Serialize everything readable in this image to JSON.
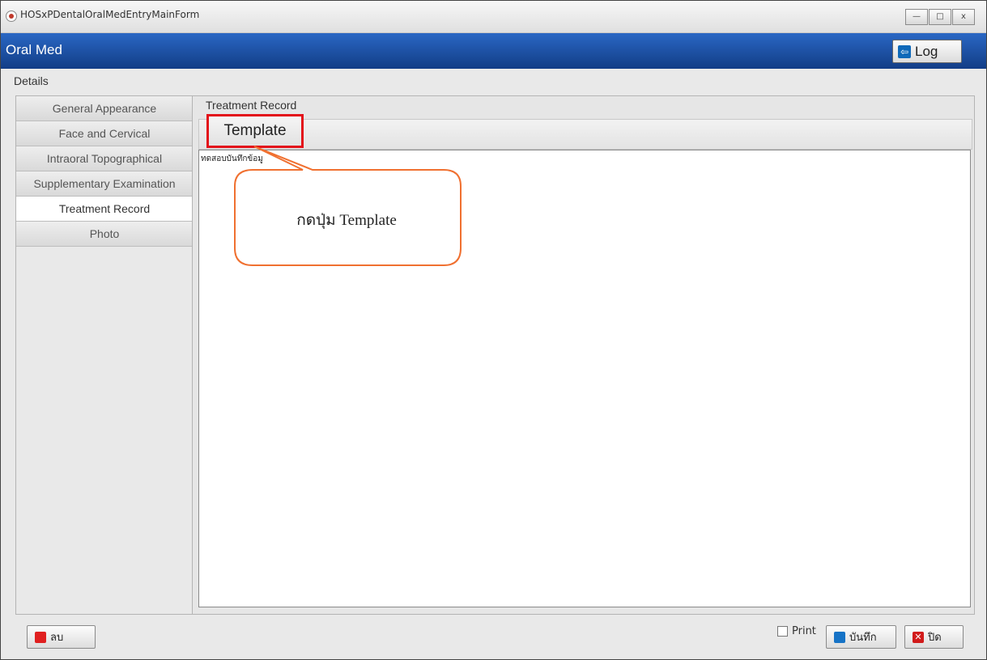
{
  "window": {
    "title": "HOSxPDentalOralMedEntryMainForm",
    "controls": {
      "minimize": "—",
      "maximize": "□",
      "close": "x"
    }
  },
  "header": {
    "title": "Oral Med",
    "log_label": "Log",
    "log_icon": "logout-arrow-icon"
  },
  "details_label": "Details",
  "sidebar": {
    "items": [
      {
        "label": "General Appearance",
        "active": false
      },
      {
        "label": "Face and Cervical",
        "active": false
      },
      {
        "label": "Intraoral Topographical",
        "active": false
      },
      {
        "label": "Supplementary Examination",
        "active": false
      },
      {
        "label": "Treatment Record",
        "active": true
      },
      {
        "label": "Photo",
        "active": false
      }
    ]
  },
  "panel": {
    "title": "Treatment Record",
    "template_label": "Template",
    "editor_text": "ทดสอบบันทึกข้อมู"
  },
  "callout": {
    "text": "กดปุ่ม Template",
    "color": "#f07030"
  },
  "bottom": {
    "delete_label": "ลบ",
    "print_label": "Print",
    "save_label": "บันทึก",
    "close_label": "ปิด"
  },
  "colors": {
    "header_start": "#2a67c4",
    "header_end": "#123d86",
    "highlight": "#e3101a"
  }
}
